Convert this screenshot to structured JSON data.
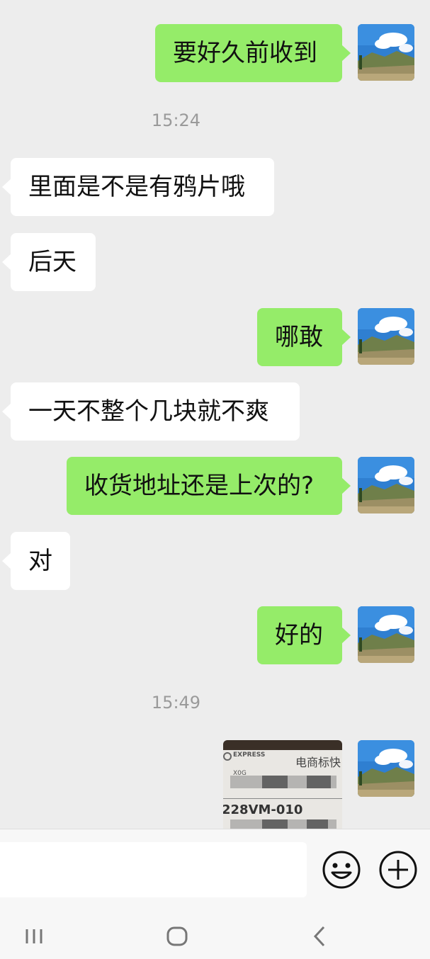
{
  "messages": [
    {
      "side": "me",
      "text": "要好久前收到"
    },
    {
      "type": "time",
      "text": "15:24"
    },
    {
      "side": "them",
      "text": "里面是不是有鸦片哦"
    },
    {
      "side": "them",
      "text": "后天"
    },
    {
      "side": "me",
      "text": "哪敢"
    },
    {
      "side": "them",
      "text": "一天不整个几块就不爽"
    },
    {
      "side": "me",
      "text": "收货地址还是上次的?"
    },
    {
      "side": "them",
      "text": "对"
    },
    {
      "side": "me",
      "text": "好的"
    },
    {
      "type": "time",
      "text": "15:49"
    },
    {
      "side": "me",
      "type": "image",
      "text_lines": [
        "EXPRESS",
        "电商标快",
        "X0G",
        "228VM-010"
      ]
    }
  ],
  "photo": {
    "brand": "EXPRESS",
    "label": "电商标快",
    "code_small": "X0G",
    "code_big": "228VM-010"
  },
  "input_bar": {
    "placeholder": "",
    "icons": [
      "emoji-icon",
      "plus-icon"
    ]
  },
  "nav_bar": {
    "icons": [
      "recent-apps-icon",
      "home-icon",
      "back-icon"
    ]
  },
  "colors": {
    "background": "#ededed",
    "my_bubble": "#95ec69",
    "their_bubble": "#ffffff",
    "timestamp": "#9a9a9a"
  }
}
